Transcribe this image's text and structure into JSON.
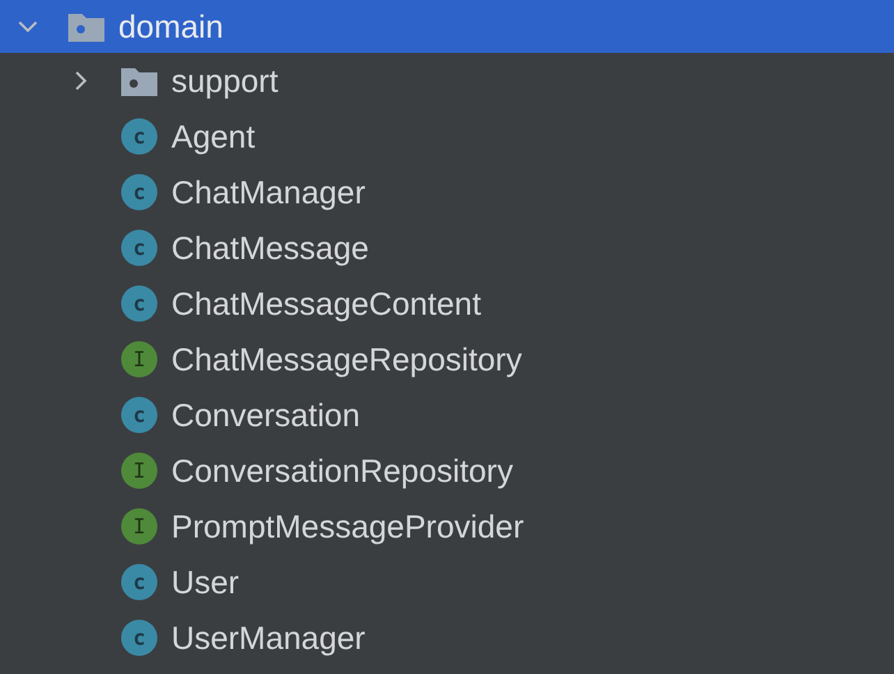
{
  "tree": {
    "label": "domain",
    "kind": "package",
    "expanded": true,
    "selected": true,
    "children": [
      {
        "label": "support",
        "kind": "package",
        "expanded": false,
        "selected": false
      },
      {
        "label": "Agent",
        "kind": "class",
        "badge": "c",
        "selected": false
      },
      {
        "label": "ChatManager",
        "kind": "class",
        "badge": "c",
        "selected": false
      },
      {
        "label": "ChatMessage",
        "kind": "class",
        "badge": "c",
        "selected": false
      },
      {
        "label": "ChatMessageContent",
        "kind": "class",
        "badge": "c",
        "selected": false
      },
      {
        "label": "ChatMessageRepository",
        "kind": "interface",
        "badge": "I",
        "selected": false
      },
      {
        "label": "Conversation",
        "kind": "class",
        "badge": "c",
        "selected": false
      },
      {
        "label": "ConversationRepository",
        "kind": "interface",
        "badge": "I",
        "selected": false
      },
      {
        "label": "PromptMessageProvider",
        "kind": "interface",
        "badge": "I",
        "selected": false
      },
      {
        "label": "User",
        "kind": "class",
        "badge": "c",
        "selected": false
      },
      {
        "label": "UserManager",
        "kind": "class",
        "badge": "c",
        "selected": false
      }
    ]
  }
}
